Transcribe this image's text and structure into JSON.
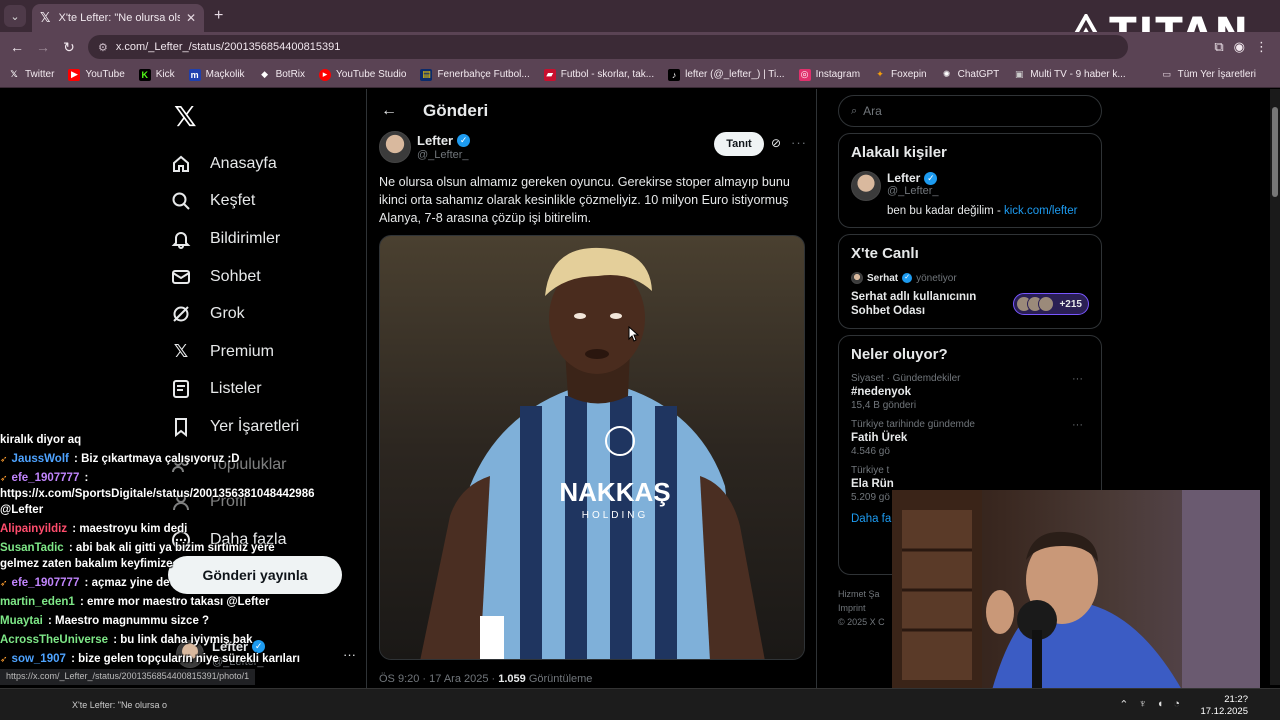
{
  "browser": {
    "tab_title": "X'te Lefter: \"Ne olursa olsun alm",
    "url": "x.com/_Lefter_/status/2001356854400815391",
    "bookmarks": [
      {
        "label": "Twitter",
        "icon": "x-logo-icon",
        "color": "#000000"
      },
      {
        "label": "YouTube",
        "icon": "youtube-icon",
        "color": "#ff0000"
      },
      {
        "label": "Kick",
        "icon": "kick-icon",
        "color": "#53fc18"
      },
      {
        "label": "Maçkolik",
        "icon": "mackolik-icon",
        "color": "#1e40af"
      },
      {
        "label": "BotRix",
        "icon": "botrix-icon",
        "color": "#ffffff"
      },
      {
        "label": "YouTube Studio",
        "icon": "youtube-studio-icon",
        "color": "#ff0000"
      },
      {
        "label": "Fenerbahçe Futbol...",
        "icon": "fenerbahce-icon",
        "color": "#0a2a6b"
      },
      {
        "label": "Futbol - skorlar, tak...",
        "icon": "flashscore-icon",
        "color": "#c8102e"
      },
      {
        "label": "lefter (@_lefter_) | Ti...",
        "icon": "tiktok-icon",
        "color": "#000000"
      },
      {
        "label": "Instagram",
        "icon": "instagram-icon",
        "color": "#e1306c"
      },
      {
        "label": "Foxepin",
        "icon": "foxepin-icon",
        "color": "#f59e0b"
      },
      {
        "label": "ChatGPT",
        "icon": "chatgpt-icon",
        "color": "#ffffff"
      },
      {
        "label": "Multi TV - 9 haber k...",
        "icon": "multitv-icon",
        "color": "#cccccc"
      }
    ],
    "all_bookmarks": "Tüm Yer İşaretleri",
    "overlay_brand": "TITAN"
  },
  "nav": {
    "items": [
      {
        "label": "Anasayfa",
        "icon": "home-icon"
      },
      {
        "label": "Keşfet",
        "icon": "search-icon"
      },
      {
        "label": "Bildirimler",
        "icon": "bell-icon"
      },
      {
        "label": "Sohbet",
        "icon": "mail-icon"
      },
      {
        "label": "Grok",
        "icon": "grok-icon"
      },
      {
        "label": "Premium",
        "icon": "x-logo-icon"
      },
      {
        "label": "Listeler",
        "icon": "list-icon"
      },
      {
        "label": "Yer İşaretleri",
        "icon": "bookmark-icon"
      },
      {
        "label": "Topluluklar",
        "icon": "community-icon"
      },
      {
        "label": "Profil",
        "icon": "profile-icon"
      },
      {
        "label": "Daha fazla",
        "icon": "more-circle-icon"
      }
    ],
    "post_button": "Gönderi yayınla",
    "profile_name": "Lefter",
    "profile_handle": "@_Lefter_"
  },
  "main": {
    "header": "Gönderi",
    "author_name": "Lefter",
    "author_handle": "@_Lefter_",
    "follow_label": "Tanıt",
    "text": "Ne olursa olsun almamız gereken oyuncu. Gerekirse stoper almayıp bunu ikinci orta sahamız olarak kesinlikle çözmeliyiz. 10 milyon Euro istiyormuş Alanya, 7-8 arasına çözüp işi bitirelim.",
    "time": "ÖS 9:20 · 17 Ara 2025 · ",
    "views": "1.059",
    "views_label": " Görüntüleme",
    "jersey_text": "NAKKAŞ",
    "jersey_sub": "HOLDING"
  },
  "right": {
    "search_placeholder": "Ara",
    "related_title": "Alakalı kişiler",
    "related_name": "Lefter",
    "related_handle": "@_Lefter_",
    "related_bio": "ben bu kadar değilim - ",
    "related_link": "kick.com/lefter",
    "live_title": "X'te Canlı",
    "live_host": "Serhat",
    "live_role": "yönetiyor",
    "live_room": "Serhat adlı kullanıcının Sohbet Odası",
    "live_count": "+215",
    "trends_title": "Neler oluyor?",
    "trends": [
      {
        "category": "Siyaset · Gündemdekiler",
        "name": "#nedenyok",
        "count": "15,4 B gönderi"
      },
      {
        "category": "Türkiye tarihinde gündemde",
        "name": "Fatih Ürek",
        "count": "4.546 gö"
      },
      {
        "category": "Türkiye t",
        "name": "Ela Rün",
        "count": "5.209 gö"
      }
    ],
    "show_more": "Daha fa",
    "footer": [
      "Hizmet Şa",
      "Imprint",
      "© 2025 X C"
    ]
  },
  "chat": [
    {
      "user": "",
      "color": "#ffffff",
      "text": "kiralık diyor aq"
    },
    {
      "user": "JaussWolf",
      "color": "#4ea3ff",
      "text": " : Biz çıkartmaya çalışıyoruz :D",
      "badge": true
    },
    {
      "user": "efe_1907777",
      "color": "#c084fc",
      "text": " : https://x.com/SportsDigitale/status/2001356381048442986 @Lefter",
      "badge": true
    },
    {
      "user": "Alipainyildiz",
      "color": "#ff4d6d",
      "text": " : maestroyu kim dedi"
    },
    {
      "user": "SusanTadic",
      "color": "#7ee787",
      "text": " : abi bak ali gitti ya bizim sırtımız yere gelmez zaten bakalım keyfimize"
    },
    {
      "user": "efe_1907777",
      "color": "#c084fc",
      "text": " : açmaz yine de",
      "badge": true
    },
    {
      "user": "martin_eden1",
      "color": "#7ee787",
      "text": " : emre mor maestro takası @Lefter"
    },
    {
      "user": "Muaytai",
      "color": "#7ee787",
      "text": " : Maestro magnummu sizce ?"
    },
    {
      "user": "AcrossTheUniverse",
      "color": "#7ee787",
      "text": " : bu link daha iyiymiş bak"
    },
    {
      "user": "sow_1907",
      "color": "#4ea3ff",
      "text": " : bize gelen topçuların niye sürekli karıları sorun çıkarıyor aq",
      "badge": true
    }
  ],
  "status_url": "https://x.com/_Lefter_/status/2001356854400815391/photo/1",
  "taskbar": {
    "app_label": "X'te Lefter: \"Ne olursa o",
    "time": "21:2?",
    "date": "17.12.2025"
  }
}
